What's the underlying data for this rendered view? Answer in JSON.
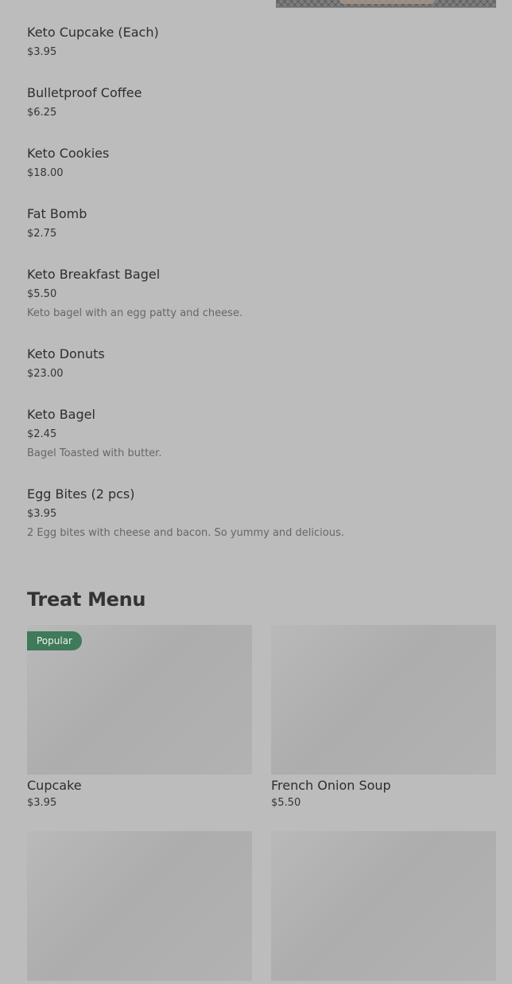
{
  "menu_items": [
    {
      "name": "Keto Cupcake (Each)",
      "price": "$3.95"
    },
    {
      "name": "Bulletproof Coffee",
      "price": "$6.25"
    },
    {
      "name": "Keto Cookies",
      "price": "$18.00"
    },
    {
      "name": "Fat Bomb",
      "price": "$2.75"
    },
    {
      "name": "Keto Breakfast Bagel",
      "price": "$5.50",
      "description": "Keto bagel with an egg patty and cheese."
    },
    {
      "name": "Keto Donuts",
      "price": "$23.00"
    },
    {
      "name": "Keto Bagel",
      "price": "$2.45",
      "description": "Bagel Toasted with butter."
    },
    {
      "name": "Egg Bites (2 pcs)",
      "price": "$3.95",
      "description": "2 Egg bites with cheese and bacon. So yummy and delicious."
    }
  ],
  "treat_menu": {
    "title": "Treat Menu",
    "cards": [
      {
        "name": "Cupcake",
        "price": "$3.95",
        "badge": "Popular"
      },
      {
        "name": "French Onion Soup",
        "price": "$5.50"
      },
      {
        "name": "",
        "price": ""
      },
      {
        "name": "",
        "price": ""
      }
    ]
  }
}
